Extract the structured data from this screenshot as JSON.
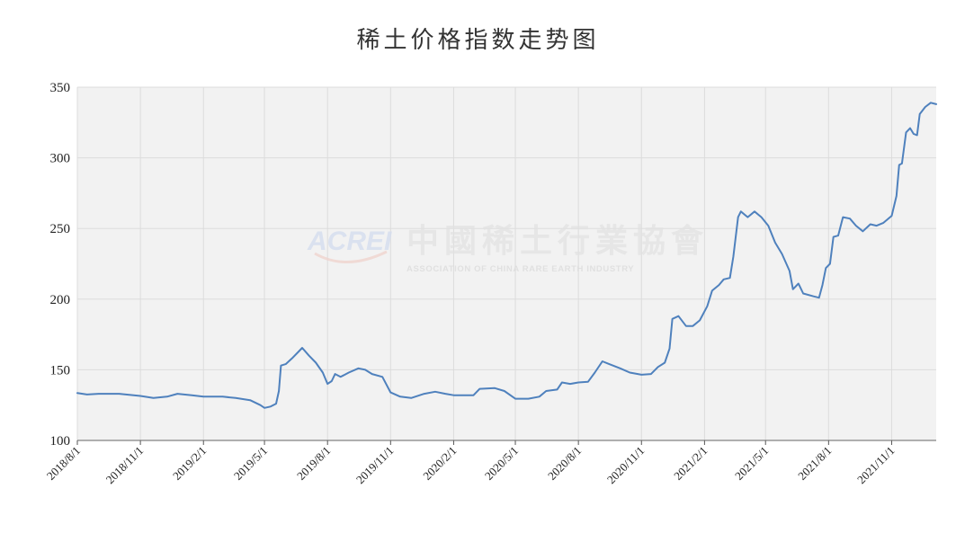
{
  "chart_data": {
    "type": "line",
    "title": "稀土价格指数走势图",
    "xlabel": "",
    "ylabel": "",
    "ylim": [
      100,
      350
    ],
    "yticks": [
      100,
      150,
      200,
      250,
      300,
      350
    ],
    "xticks": [
      "2018/8/1",
      "2018/11/1",
      "2019/2/1",
      "2019/5/1",
      "2019/8/1",
      "2019/11/1",
      "2020/2/1",
      "2020/5/1",
      "2020/8/1",
      "2020/11/1",
      "2021/2/1",
      "2021/5/1",
      "2021/8/1",
      "2021/11/1"
    ],
    "grid": true,
    "legend": "none",
    "series": [
      {
        "color": "#4f81bd",
        "points": [
          [
            "2018-08-01",
            133.5
          ],
          [
            "2018-08-15",
            132.5
          ],
          [
            "2018-09-01",
            133.0
          ],
          [
            "2018-10-01",
            133.0
          ],
          [
            "2018-11-01",
            131.5
          ],
          [
            "2018-11-20",
            130.0
          ],
          [
            "2018-12-10",
            131.0
          ],
          [
            "2018-12-25",
            133.0
          ],
          [
            "2019-01-15",
            132.0
          ],
          [
            "2019-02-01",
            131.0
          ],
          [
            "2019-03-01",
            131.0
          ],
          [
            "2019-03-20",
            130.0
          ],
          [
            "2019-04-10",
            128.5
          ],
          [
            "2019-04-25",
            125.0
          ],
          [
            "2019-05-01",
            123.0
          ],
          [
            "2019-05-10",
            124.0
          ],
          [
            "2019-05-18",
            126.0
          ],
          [
            "2019-05-22",
            135.0
          ],
          [
            "2019-05-25",
            153.0
          ],
          [
            "2019-06-01",
            154.0
          ],
          [
            "2019-06-10",
            158.0
          ],
          [
            "2019-06-20",
            163.0
          ],
          [
            "2019-06-25",
            165.5
          ],
          [
            "2019-07-05",
            160.0
          ],
          [
            "2019-07-15",
            155.0
          ],
          [
            "2019-07-25",
            148.0
          ],
          [
            "2019-08-01",
            140.0
          ],
          [
            "2019-08-07",
            142.0
          ],
          [
            "2019-08-12",
            147.0
          ],
          [
            "2019-08-20",
            145.0
          ],
          [
            "2019-09-01",
            148.0
          ],
          [
            "2019-09-15",
            151.0
          ],
          [
            "2019-09-25",
            150.0
          ],
          [
            "2019-10-05",
            147.0
          ],
          [
            "2019-10-20",
            145.0
          ],
          [
            "2019-11-01",
            134.0
          ],
          [
            "2019-11-15",
            131.0
          ],
          [
            "2019-12-01",
            130.0
          ],
          [
            "2019-12-20",
            133.0
          ],
          [
            "2020-01-05",
            134.5
          ],
          [
            "2020-01-20",
            133.0
          ],
          [
            "2020-02-01",
            132.0
          ],
          [
            "2020-03-01",
            132.0
          ],
          [
            "2020-03-10",
            136.5
          ],
          [
            "2020-04-01",
            137.0
          ],
          [
            "2020-04-15",
            135.0
          ],
          [
            "2020-05-01",
            129.5
          ],
          [
            "2020-05-20",
            129.5
          ],
          [
            "2020-06-05",
            131.0
          ],
          [
            "2020-06-15",
            135.0
          ],
          [
            "2020-07-01",
            136.0
          ],
          [
            "2020-07-08",
            141.0
          ],
          [
            "2020-07-20",
            140.0
          ],
          [
            "2020-08-01",
            141.0
          ],
          [
            "2020-08-15",
            141.5
          ],
          [
            "2020-08-25",
            148.0
          ],
          [
            "2020-09-05",
            156.0
          ],
          [
            "2020-09-15",
            154.0
          ],
          [
            "2020-10-01",
            151.0
          ],
          [
            "2020-10-15",
            148.0
          ],
          [
            "2020-11-01",
            146.5
          ],
          [
            "2020-11-15",
            147.0
          ],
          [
            "2020-11-25",
            152.0
          ],
          [
            "2020-12-05",
            155.0
          ],
          [
            "2020-12-12",
            165.0
          ],
          [
            "2020-12-16",
            186.0
          ],
          [
            "2020-12-25",
            188.0
          ],
          [
            "2021-01-05",
            181.0
          ],
          [
            "2021-01-15",
            181.0
          ],
          [
            "2021-01-25",
            185.0
          ],
          [
            "2021-02-05",
            195.0
          ],
          [
            "2021-02-12",
            206.0
          ],
          [
            "2021-02-22",
            210.0
          ],
          [
            "2021-03-01",
            214.0
          ],
          [
            "2021-03-10",
            215.0
          ],
          [
            "2021-03-15",
            230.0
          ],
          [
            "2021-03-22",
            258.0
          ],
          [
            "2021-03-26",
            262.0
          ],
          [
            "2021-04-05",
            258.0
          ],
          [
            "2021-04-15",
            262.0
          ],
          [
            "2021-04-25",
            258.0
          ],
          [
            "2021-05-05",
            252.0
          ],
          [
            "2021-05-15",
            240.0
          ],
          [
            "2021-05-25",
            232.0
          ],
          [
            "2021-06-05",
            220.0
          ],
          [
            "2021-06-10",
            207.0
          ],
          [
            "2021-06-18",
            211.0
          ],
          [
            "2021-06-25",
            204.0
          ],
          [
            "2021-07-10",
            202.0
          ],
          [
            "2021-07-18",
            201.0
          ],
          [
            "2021-07-23",
            210.0
          ],
          [
            "2021-07-28",
            222.0
          ],
          [
            "2021-08-03",
            225.0
          ],
          [
            "2021-08-08",
            244.0
          ],
          [
            "2021-08-15",
            245.0
          ],
          [
            "2021-08-22",
            258.0
          ],
          [
            "2021-09-01",
            257.0
          ],
          [
            "2021-09-10",
            252.0
          ],
          [
            "2021-09-20",
            248.0
          ],
          [
            "2021-10-01",
            253.0
          ],
          [
            "2021-10-10",
            252.0
          ],
          [
            "2021-10-20",
            254.0
          ],
          [
            "2021-11-01",
            259.0
          ],
          [
            "2021-11-08",
            273.0
          ],
          [
            "2021-11-12",
            295.0
          ],
          [
            "2021-11-16",
            296.0
          ],
          [
            "2021-11-22",
            318.0
          ],
          [
            "2021-11-28",
            321.0
          ],
          [
            "2021-12-03",
            317.0
          ],
          [
            "2021-12-08",
            316.0
          ],
          [
            "2021-12-12",
            331.0
          ],
          [
            "2021-12-20",
            336.0
          ],
          [
            "2021-12-28",
            339.0
          ],
          [
            "2022-01-05",
            338.0
          ]
        ]
      }
    ]
  },
  "watermark": {
    "logo_text": "ACREI",
    "name_cn": "中國稀土行業協會",
    "name_en": "ASSOCIATION OF CHINA RARE EARTH INDUSTRY"
  }
}
